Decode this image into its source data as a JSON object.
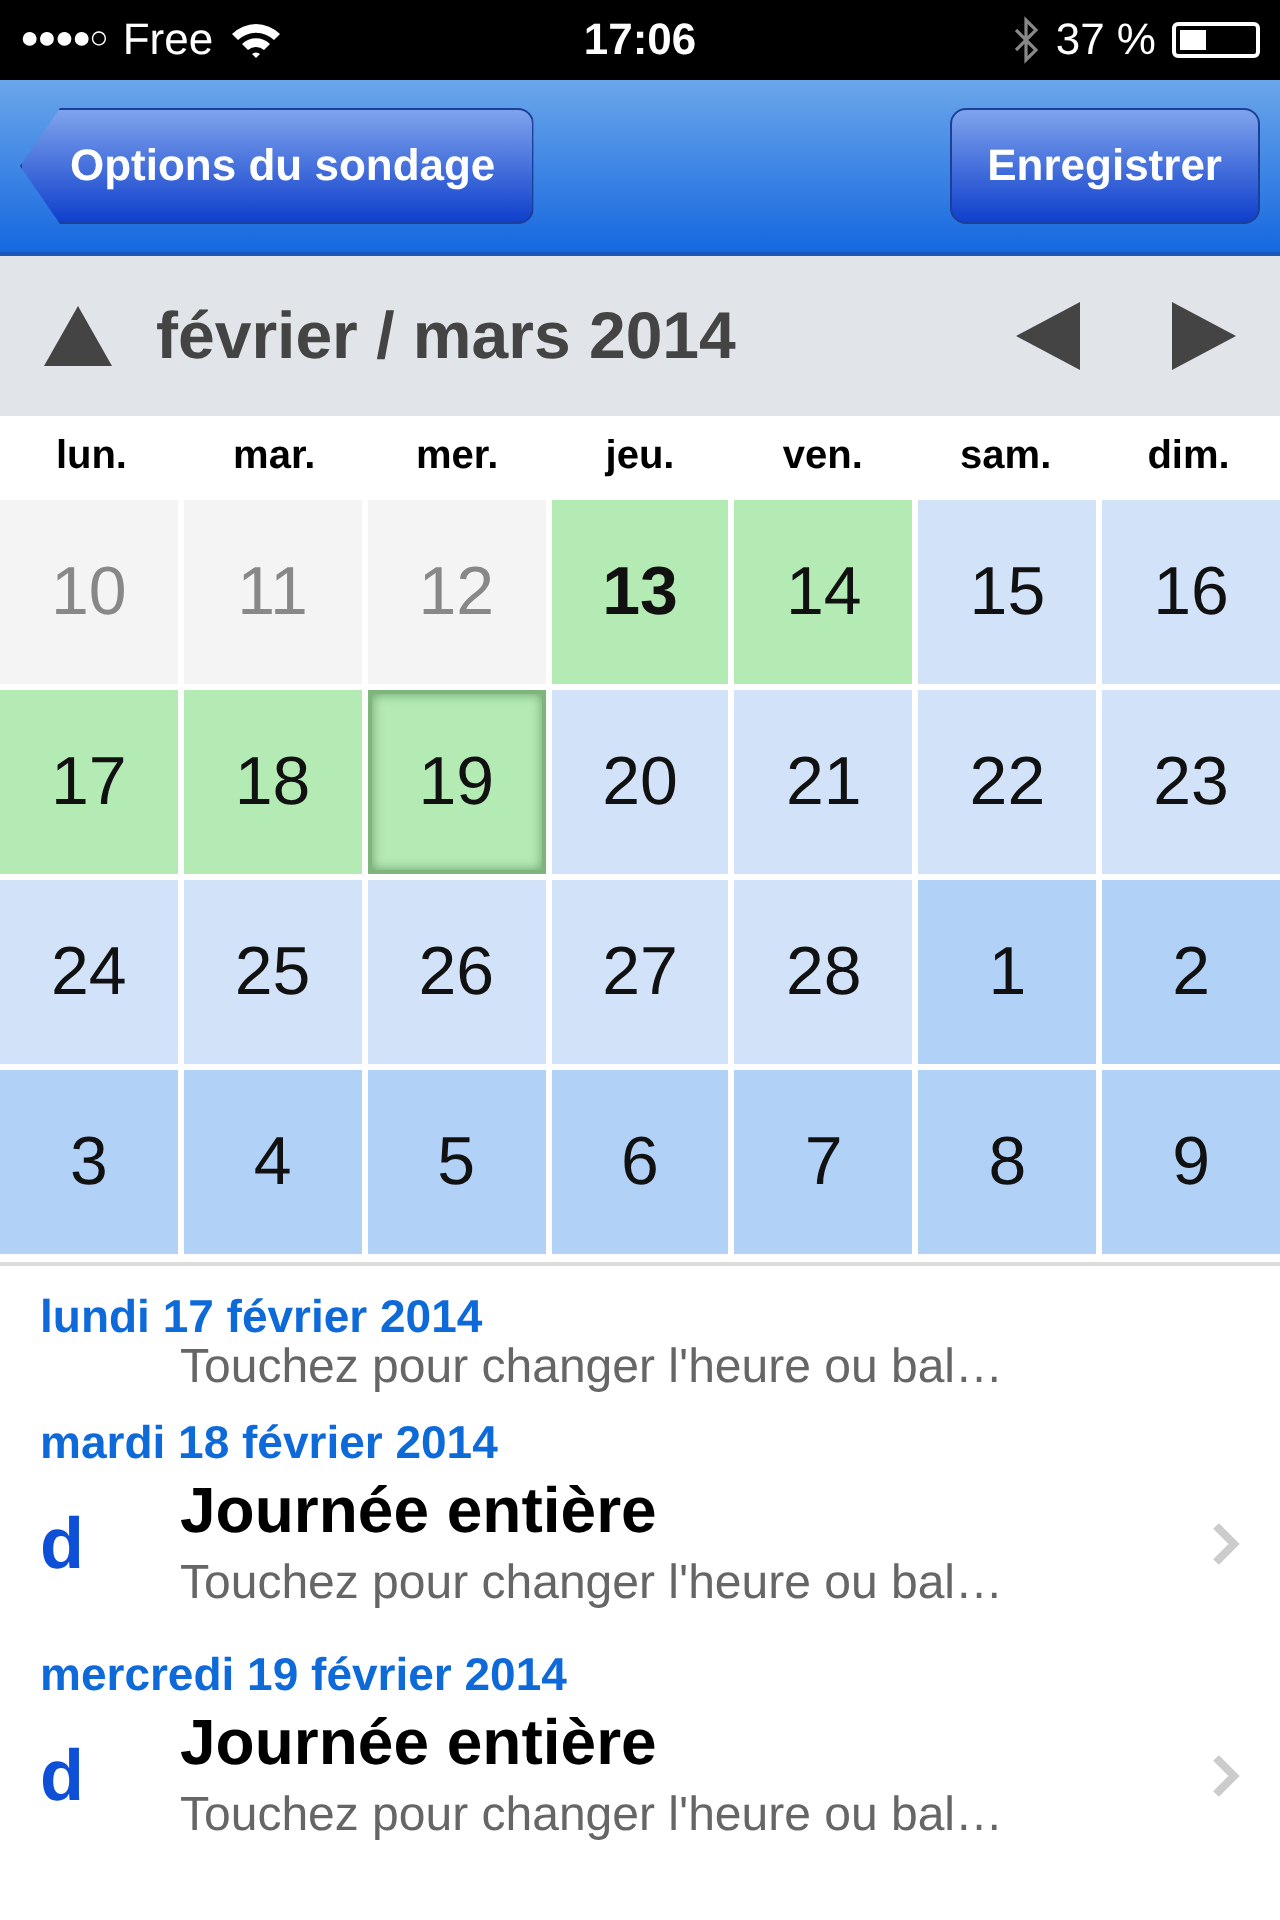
{
  "status_bar": {
    "signal_bars": "●●●●○",
    "carrier": "Free",
    "time": "17:06",
    "battery": "37 %"
  },
  "nav_bar": {
    "back_button": "Options du sondage",
    "save_button": "Enregistrer"
  },
  "calendar": {
    "title": "février / mars 2014",
    "weekdays": [
      "lun.",
      "mar.",
      "mer.",
      "jeu.",
      "ven.",
      "sam.",
      "dim."
    ],
    "days": [
      {
        "label": "10",
        "kind": "past",
        "selected": false,
        "focused": false
      },
      {
        "label": "11",
        "kind": "past",
        "selected": false,
        "focused": false
      },
      {
        "label": "12",
        "kind": "past",
        "selected": false,
        "focused": false
      },
      {
        "label": "13",
        "kind": "today",
        "selected": true,
        "focused": false
      },
      {
        "label": "14",
        "kind": "open",
        "selected": true,
        "focused": false
      },
      {
        "label": "15",
        "kind": "open",
        "selected": false,
        "focused": false
      },
      {
        "label": "16",
        "kind": "open",
        "selected": false,
        "focused": false
      },
      {
        "label": "17",
        "kind": "open",
        "selected": true,
        "focused": false
      },
      {
        "label": "18",
        "kind": "open",
        "selected": true,
        "focused": false
      },
      {
        "label": "19",
        "kind": "open",
        "selected": true,
        "focused": true
      },
      {
        "label": "20",
        "kind": "open",
        "selected": false,
        "focused": false
      },
      {
        "label": "21",
        "kind": "open",
        "selected": false,
        "focused": false
      },
      {
        "label": "22",
        "kind": "open",
        "selected": false,
        "focused": false
      },
      {
        "label": "23",
        "kind": "open",
        "selected": false,
        "focused": false
      },
      {
        "label": "24",
        "kind": "open",
        "selected": false,
        "focused": false
      },
      {
        "label": "25",
        "kind": "open",
        "selected": false,
        "focused": false
      },
      {
        "label": "26",
        "kind": "open",
        "selected": false,
        "focused": false
      },
      {
        "label": "27",
        "kind": "open",
        "selected": false,
        "focused": false
      },
      {
        "label": "28",
        "kind": "open",
        "selected": false,
        "focused": false
      },
      {
        "label": "1",
        "kind": "next",
        "selected": false,
        "focused": false
      },
      {
        "label": "2",
        "kind": "next",
        "selected": false,
        "focused": false
      },
      {
        "label": "3",
        "kind": "next",
        "selected": false,
        "focused": false
      },
      {
        "label": "4",
        "kind": "next",
        "selected": false,
        "focused": false
      },
      {
        "label": "5",
        "kind": "next",
        "selected": false,
        "focused": false
      },
      {
        "label": "6",
        "kind": "next",
        "selected": false,
        "focused": false
      },
      {
        "label": "7",
        "kind": "next",
        "selected": false,
        "focused": false
      },
      {
        "label": "8",
        "kind": "next",
        "selected": false,
        "focused": false
      },
      {
        "label": "9",
        "kind": "next",
        "selected": false,
        "focused": false
      }
    ]
  },
  "list": [
    {
      "header": "lundi 17 février 2014",
      "subtitle": "Touchez pour changer l'heure ou bal…"
    },
    {
      "header": "mardi 18 février 2014",
      "icon": "d",
      "title": "Journée entière",
      "subtitle": "Touchez pour changer l'heure ou bal…"
    },
    {
      "header": "mercredi 19 février 2014",
      "icon": "d",
      "title": "Journée entière",
      "subtitle": "Touchez pour changer l'heure ou bal…"
    }
  ]
}
